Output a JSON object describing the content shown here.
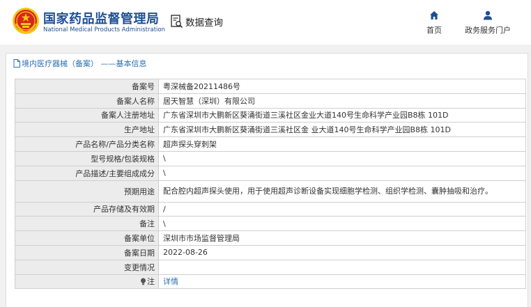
{
  "header": {
    "brand_cn": "国家药品监督管理局",
    "brand_en": "National Medical Products Administration",
    "query_label": "数据查询",
    "nav": {
      "home_label": "首页",
      "portal_label": "政务服务门户"
    }
  },
  "panel": {
    "title": "境内医疗器械（备案） ——基本信息"
  },
  "record": {
    "filing_no": {
      "label": "备案号",
      "value": "粤深械备20211486号"
    },
    "filer_name": {
      "label": "备案人名称",
      "value": "居天智慧（深圳）有限公司"
    },
    "filer_address": {
      "label": "备案人注册地址",
      "value": "广东省深圳市大鹏新区葵涌街道三溪社区金业大道140号生命科学产业园B8栋 101D"
    },
    "production_address": {
      "label": "生产地址",
      "value": "广东省深圳市大鹏新区葵涌街道三溪社区金 业大道140号生命科学产业园B8栋 101D"
    },
    "product_name": {
      "label": "产品名称/产品分类名称",
      "value": "超声探头穿刺架"
    },
    "model": {
      "label": "型号规格/包装规格",
      "value": "\\"
    },
    "description": {
      "label": "产品描述/主要组成成分",
      "value": "\\"
    },
    "intended_use": {
      "label": "预期用途",
      "value": "配合腔内超声探头使用，用于使用超声诊断设备实现细胞学检测、组织学检测、囊肿抽吸和治疗。"
    },
    "storage": {
      "label": "产品存储及有效期",
      "value": "/"
    },
    "remarks": {
      "label": "备注",
      "value": "\\"
    },
    "filing_unit": {
      "label": "备案单位",
      "value": "深圳市市场监督管理局"
    },
    "filing_date": {
      "label": "备案日期",
      "value": "2022-08-26"
    },
    "changes": {
      "label": "变更情况",
      "value": ""
    },
    "note": {
      "label": "注",
      "value": "详情"
    }
  },
  "colors": {
    "brand_blue": "#1d4f91",
    "link_blue": "#2c6fb3",
    "emblem_red": "#d7261c",
    "emblem_gold": "#f5c518"
  },
  "icons": [
    "national-emblem",
    "data-query-icon",
    "home-icon",
    "user-icon",
    "document-icon",
    "lightbulb-icon"
  ]
}
